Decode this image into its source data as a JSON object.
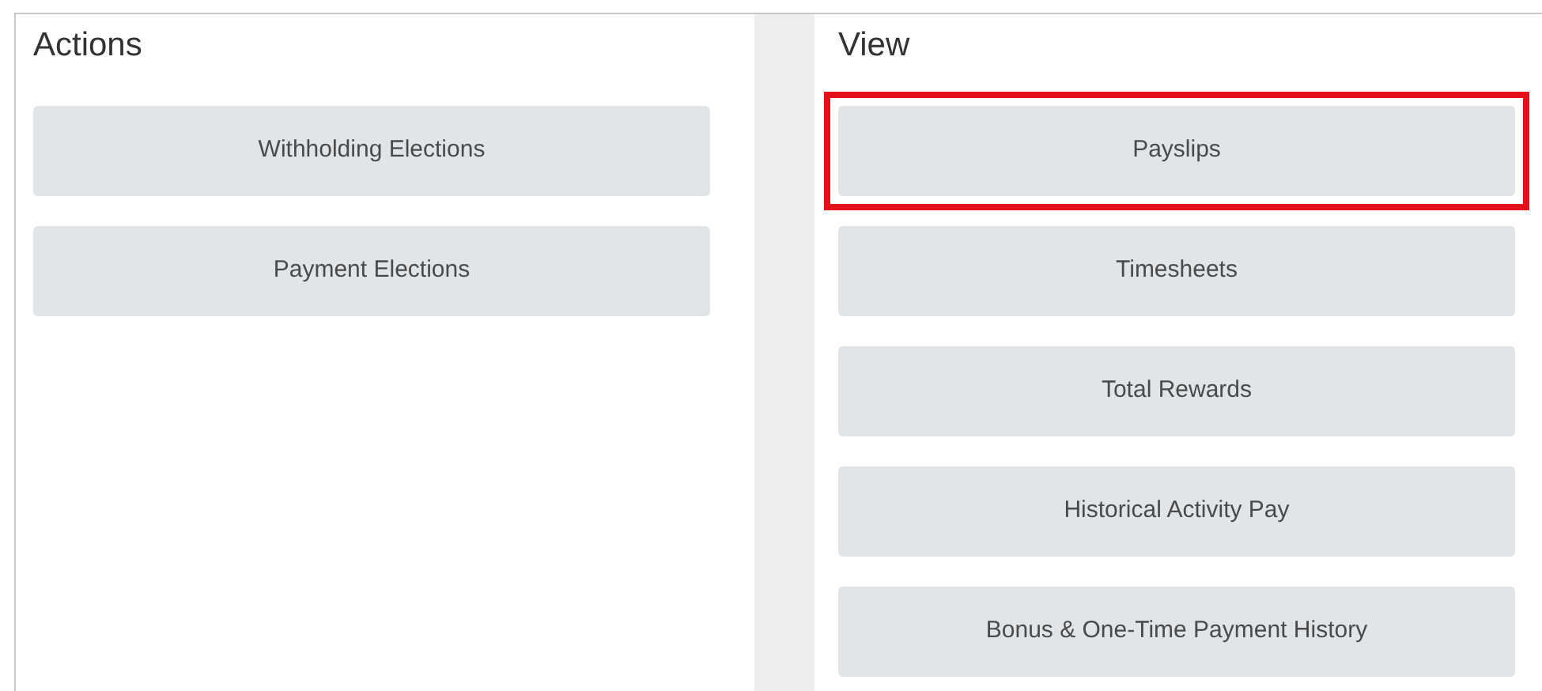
{
  "actions": {
    "title": "Actions",
    "buttons": [
      {
        "label": "Withholding Elections",
        "highlighted": false
      },
      {
        "label": "Payment Elections",
        "highlighted": false
      }
    ]
  },
  "view": {
    "title": "View",
    "buttons": [
      {
        "label": "Payslips",
        "highlighted": true
      },
      {
        "label": "Timesheets",
        "highlighted": false
      },
      {
        "label": "Total Rewards",
        "highlighted": false
      },
      {
        "label": "Historical Activity Pay",
        "highlighted": false
      },
      {
        "label": "Bonus & One-Time Payment History",
        "highlighted": false
      }
    ]
  }
}
